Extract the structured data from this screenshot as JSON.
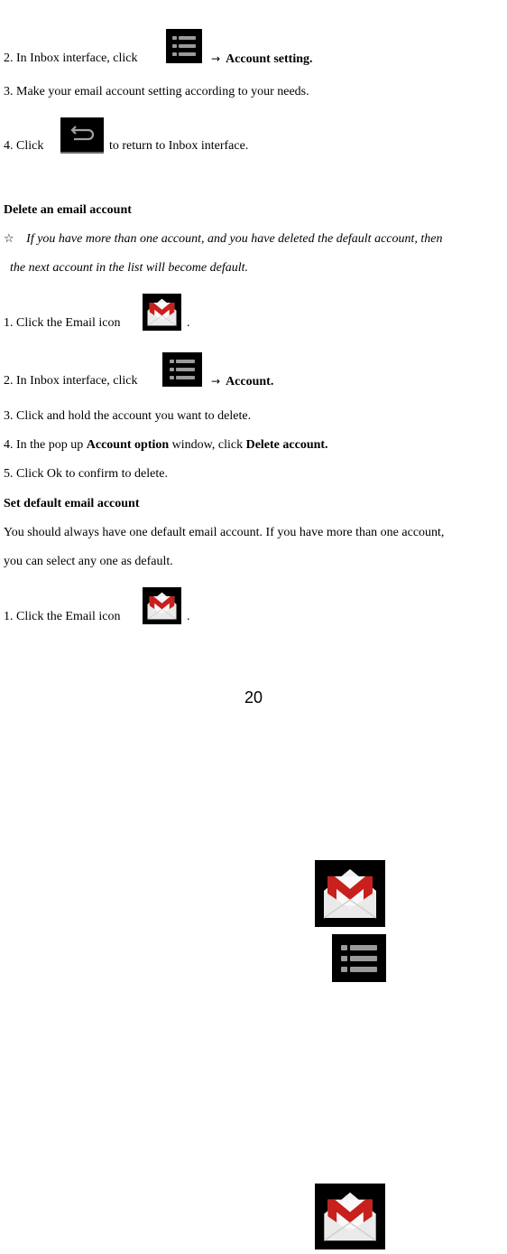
{
  "section1": {
    "step2": {
      "prefix": "2.  In Inbox interface, click",
      "arrow": "→",
      "target": "Account setting."
    },
    "step3": "3.  Make your email account setting according to your needs.",
    "step4": {
      "prefix": "4.  Click",
      "suffix": "to return to Inbox interface."
    }
  },
  "delete_section": {
    "heading": "Delete an email account",
    "note_symbol": "☆",
    "note_line1": "If you have more than one account, and you have deleted the default account, then",
    "note_line2": "the next account in the list will become default.",
    "step1": {
      "prefix": "1. Click the Email icon",
      "suffix": "."
    },
    "step2": {
      "prefix": "2. In Inbox interface, click",
      "arrow": "→",
      "target": "Account."
    },
    "step3": "3. Click and hold the account you want to delete.",
    "step4": {
      "prefix": "4. In the pop up",
      "bold1": "Account option",
      "middle": "window, click",
      "bold2": "Delete account."
    },
    "step5": "5. Click Ok to confirm to delete."
  },
  "default_section": {
    "heading": "Set default email account",
    "para_line1": "You should always have one default email account. If you have more than one account,",
    "para_line2": "you can select any one as default.",
    "step1": {
      "prefix": "1. Click the Email icon",
      "suffix": "."
    }
  },
  "page_number": "20",
  "icons": {
    "menu": "menu-icon",
    "back": "back-icon",
    "email": "gmail-email-icon"
  },
  "colors": {
    "gmail_red": "#c8201c",
    "icon_bg": "#000000",
    "icon_grey": "#9a9a9a"
  }
}
